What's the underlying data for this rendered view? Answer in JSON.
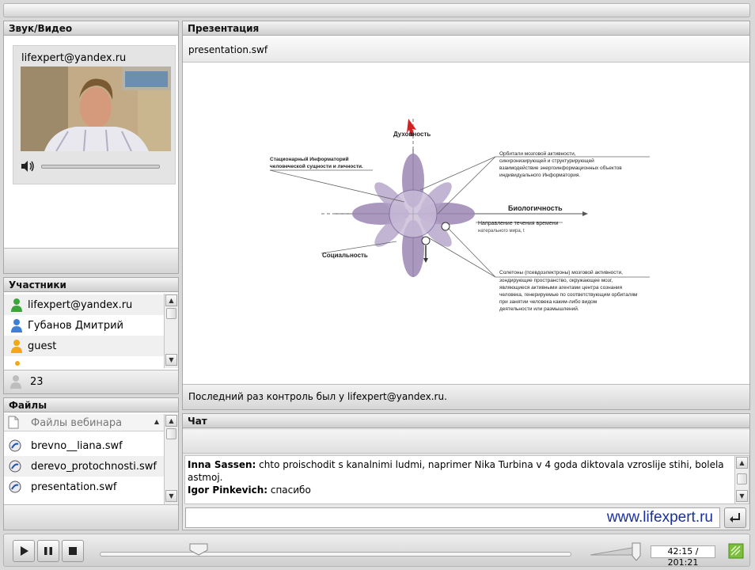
{
  "panels": {
    "av_title": "Звук/Видео",
    "presentation_title": "Презентация",
    "participants_title": "Участники",
    "files_title": "Файлы",
    "chat_title": "Чат"
  },
  "video": {
    "user": "lifexpert@yandex.ru",
    "volume_level": 0.0
  },
  "presentation": {
    "filename": "presentation.swf",
    "last_control": "Последний раз контроль был у lifexpert@yandex.ru."
  },
  "diagram": {
    "label_top": "Духовность",
    "label_right": "Биологичность",
    "label_bottom": "Социальность",
    "left_title_1": "Стационарный Информаторий",
    "left_title_2": "человеческой сущности и личности.",
    "orbitals_1": "Орбитали мозговой активности,",
    "orbitals_2": "синхронизирующей и структурирующей",
    "orbitals_3": "взаимодействие энергоинформационных объектов",
    "orbitals_4": "индивидуального Информатория.",
    "time_1": "Направление течения времени",
    "time_2": "натерального мира, t",
    "soletons_1": "Солетоны (псевдоэлектроны) мозговой активности,",
    "soletons_2": "зондирующие пространство, окружающее мозг,",
    "soletons_3": "являющиеся активными агентами центра сознания",
    "soletons_4": "человека, генерируемые по соответствующим орбиталям",
    "soletons_5": "при занятии человека каким-либо видом",
    "soletons_6": "деятельности или размышлений."
  },
  "participants": {
    "items": [
      {
        "name": "lifexpert@yandex.ru",
        "color": "#3aa63a"
      },
      {
        "name": "Губанов Дмитрий",
        "color": "#3f7fd8"
      },
      {
        "name": "guest",
        "color": "#f0a818"
      }
    ],
    "count": "23"
  },
  "files": {
    "header": "Файлы вебинара",
    "items": [
      "brevno__liana.swf",
      "derevo_protochnosti.swf",
      "presentation.swf"
    ]
  },
  "chat": {
    "messages": [
      {
        "author": "Inna Sassen:",
        "text": " chto proischodit s kanalnimi ludmi, naprimer Nika Turbina v 4 goda diktovala vzroslije stihi, bolela astmoj."
      },
      {
        "author": "Igor Pinkevich:",
        "text": " спасибо"
      }
    ],
    "input_value": "",
    "watermark": "www.lifexpert.ru"
  },
  "playback": {
    "time": "42:15 / 201:21",
    "progress": 0.21,
    "volume": 1.0
  }
}
